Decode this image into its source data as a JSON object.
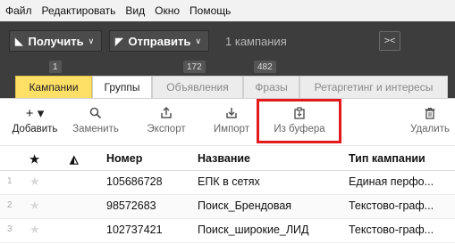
{
  "menu": [
    "Файл",
    "Редактировать",
    "Вид",
    "Окно",
    "Помощь"
  ],
  "toolbar": {
    "get_label": "Получить",
    "send_label": "Отправить",
    "campaign_count": "1 кампания"
  },
  "badges": [
    "1",
    "172",
    "482"
  ],
  "tabs": [
    "Кампании",
    "Группы",
    "Объявления",
    "Фразы",
    "Ретаргетинг и интересы"
  ],
  "tools": [
    {
      "label": "Добавить",
      "icon": "plus-icon",
      "glyph": "+ ▾"
    },
    {
      "label": "Заменить",
      "icon": "search-icon",
      "glyph": "🔍"
    },
    {
      "label": "Экспорт",
      "icon": "export-icon",
      "glyph": "⇪"
    },
    {
      "label": "Импорт",
      "icon": "import-icon",
      "glyph": "⇩"
    },
    {
      "label": "Из буфера",
      "icon": "clipboard-icon",
      "glyph": "⎘"
    },
    {
      "label": "Удалить",
      "icon": "trash-icon",
      "glyph": "🗑"
    }
  ],
  "table": {
    "columns": [
      "★",
      "◭",
      "Номер",
      "Название",
      "Тип кампании"
    ],
    "rows": [
      {
        "num": "1",
        "id": "105686728",
        "name": "ЕПК в сетях",
        "type": "Единая перфо..."
      },
      {
        "num": "2",
        "id": "98572683",
        "name": "Поиск_Брендовая",
        "type": "Текстово-граф..."
      },
      {
        "num": "3",
        "id": "102737421",
        "name": "Поиск_широкие_ЛИД",
        "type": "Текстово-граф..."
      }
    ]
  },
  "colors": {
    "active_tab": "#ffe066",
    "highlight": "#e3191c",
    "toolbar": "#3d3d3d"
  }
}
